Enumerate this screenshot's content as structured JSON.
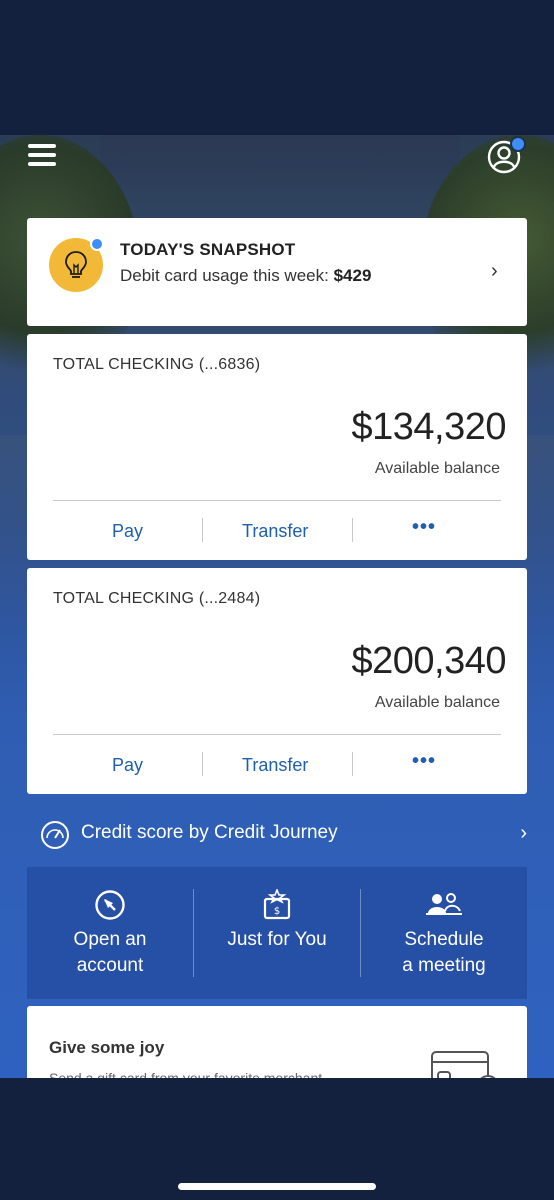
{
  "header": {
    "menu_icon": "hamburger-icon",
    "profile_icon": "profile-icon",
    "notification_color": "#3e8ef7"
  },
  "snapshot": {
    "title": "TODAY'S SNAPSHOT",
    "text": "Debit card usage this week:",
    "amount": "$429",
    "icon": "lightbulb-icon",
    "icon_bg": "#f2b938"
  },
  "accounts": [
    {
      "name": "TOTAL CHECKING (...6836)",
      "balance": "$134,320",
      "balance_label": "Available balance",
      "actions": {
        "pay": "Pay",
        "transfer": "Transfer",
        "more": "•••"
      }
    },
    {
      "name": "TOTAL CHECKING (...2484)",
      "balance": "$200,340",
      "balance_label": "Available balance",
      "actions": {
        "pay": "Pay",
        "transfer": "Transfer",
        "more": "•••"
      }
    }
  ],
  "credit_journey": {
    "label": "Credit score by Credit Journey",
    "icon": "speedometer-icon"
  },
  "quick_actions": [
    {
      "line1": "Open an",
      "line2": "account",
      "icon": "compass-icon"
    },
    {
      "line1": "Just for You",
      "line2": "",
      "icon": "gift-card-icon"
    },
    {
      "line1": "Schedule",
      "line2": "a meeting",
      "icon": "people-icon"
    }
  ],
  "joy": {
    "title": "Give some joy",
    "text": "Send a gift card from your favorite merchant",
    "icon": "gift-card-illustration"
  },
  "colors": {
    "accent_link": "#1f5fae",
    "quick_actions_bg": "#264fa6",
    "frame": "#13213f"
  }
}
